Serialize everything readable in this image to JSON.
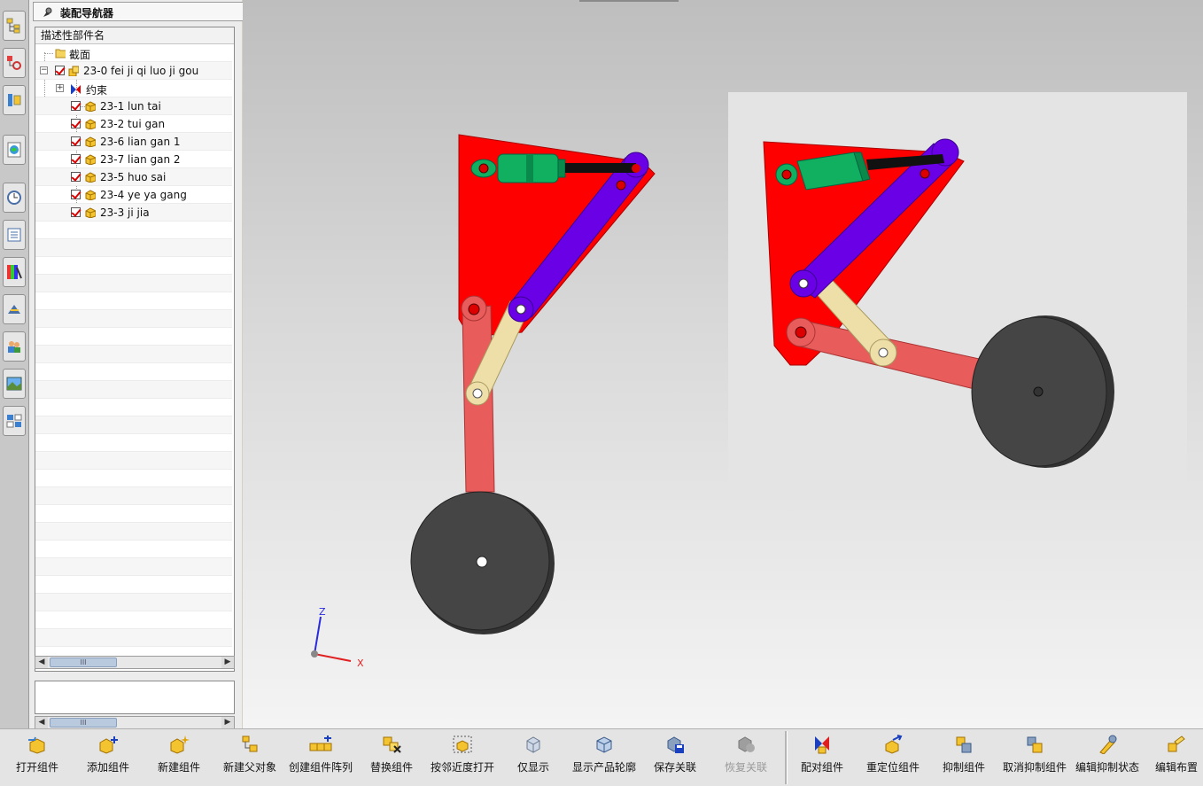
{
  "navigator": {
    "title": "装配导航器",
    "column_header": "描述性部件名",
    "nodes": [
      {
        "label": "截面",
        "type": "folder"
      },
      {
        "label": "23-0 fei ji qi luo ji gou",
        "type": "assembly",
        "checked": true
      },
      {
        "label": "约束",
        "type": "constraints"
      },
      {
        "label": "23-1 lun tai",
        "type": "part",
        "checked": true
      },
      {
        "label": "23-2 tui gan",
        "type": "part",
        "checked": true
      },
      {
        "label": "23-6 lian gan 1",
        "type": "part",
        "checked": true
      },
      {
        "label": "23-7 lian gan 2",
        "type": "part",
        "checked": true
      },
      {
        "label": "23-5 huo sai",
        "type": "part",
        "checked": true
      },
      {
        "label": "23-4 ye ya gang",
        "type": "part",
        "checked": true
      },
      {
        "label": "23-3 ji jia",
        "type": "part",
        "checked": true
      }
    ]
  },
  "resource_bar": {
    "icons": [
      "assembly-navigator-icon",
      "constraint-navigator-icon",
      "part-navigator-icon",
      "web-browser-icon",
      "history-icon",
      "reuse-library-icon",
      "system-materials-icon",
      "process-studio-icon",
      "roles-icon",
      "system-scenes-icon",
      "palette-icon"
    ]
  },
  "graphics": {
    "axis_labels": {
      "z": "Z",
      "x": "X"
    },
    "colors": {
      "frame": "#ff0000",
      "link_purple": "#6a00e6",
      "link_beige": "#eedfa8",
      "strut": "#e85c5c",
      "cylinder": "#10b060",
      "wheel": "#454545"
    }
  },
  "toolbar": {
    "buttons": [
      {
        "label": "打开组件",
        "icon": "open-component-icon",
        "enabled": true
      },
      {
        "label": "添加组件",
        "icon": "add-component-icon",
        "enabled": true
      },
      {
        "label": "新建组件",
        "icon": "new-component-icon",
        "enabled": true
      },
      {
        "label": "新建父对象",
        "icon": "new-parent-icon",
        "enabled": true
      },
      {
        "label": "创建组件阵列",
        "icon": "component-array-icon",
        "enabled": true
      },
      {
        "label": "替换组件",
        "icon": "replace-component-icon",
        "enabled": true
      },
      {
        "label": "按邻近度打开",
        "icon": "open-by-proximity-icon",
        "enabled": true
      },
      {
        "label": "仅显示",
        "icon": "show-only-icon",
        "enabled": true
      },
      {
        "label": "显示产品轮廓",
        "icon": "show-product-outline-icon",
        "enabled": true
      },
      {
        "label": "保存关联",
        "icon": "save-association-icon",
        "enabled": true
      },
      {
        "label": "恢复关联",
        "icon": "restore-association-icon",
        "enabled": false
      },
      {
        "label": "配对组件",
        "icon": "mate-component-icon",
        "enabled": true
      },
      {
        "label": "重定位组件",
        "icon": "reposition-component-icon",
        "enabled": true
      },
      {
        "label": "抑制组件",
        "icon": "suppress-component-icon",
        "enabled": true
      },
      {
        "label": "取消抑制组件",
        "icon": "unsuppress-component-icon",
        "enabled": true
      },
      {
        "label": "编辑抑制状态",
        "icon": "edit-suppression-state-icon",
        "enabled": true
      },
      {
        "label": "编辑布置",
        "icon": "edit-arrangement-icon",
        "enabled": true
      }
    ]
  }
}
